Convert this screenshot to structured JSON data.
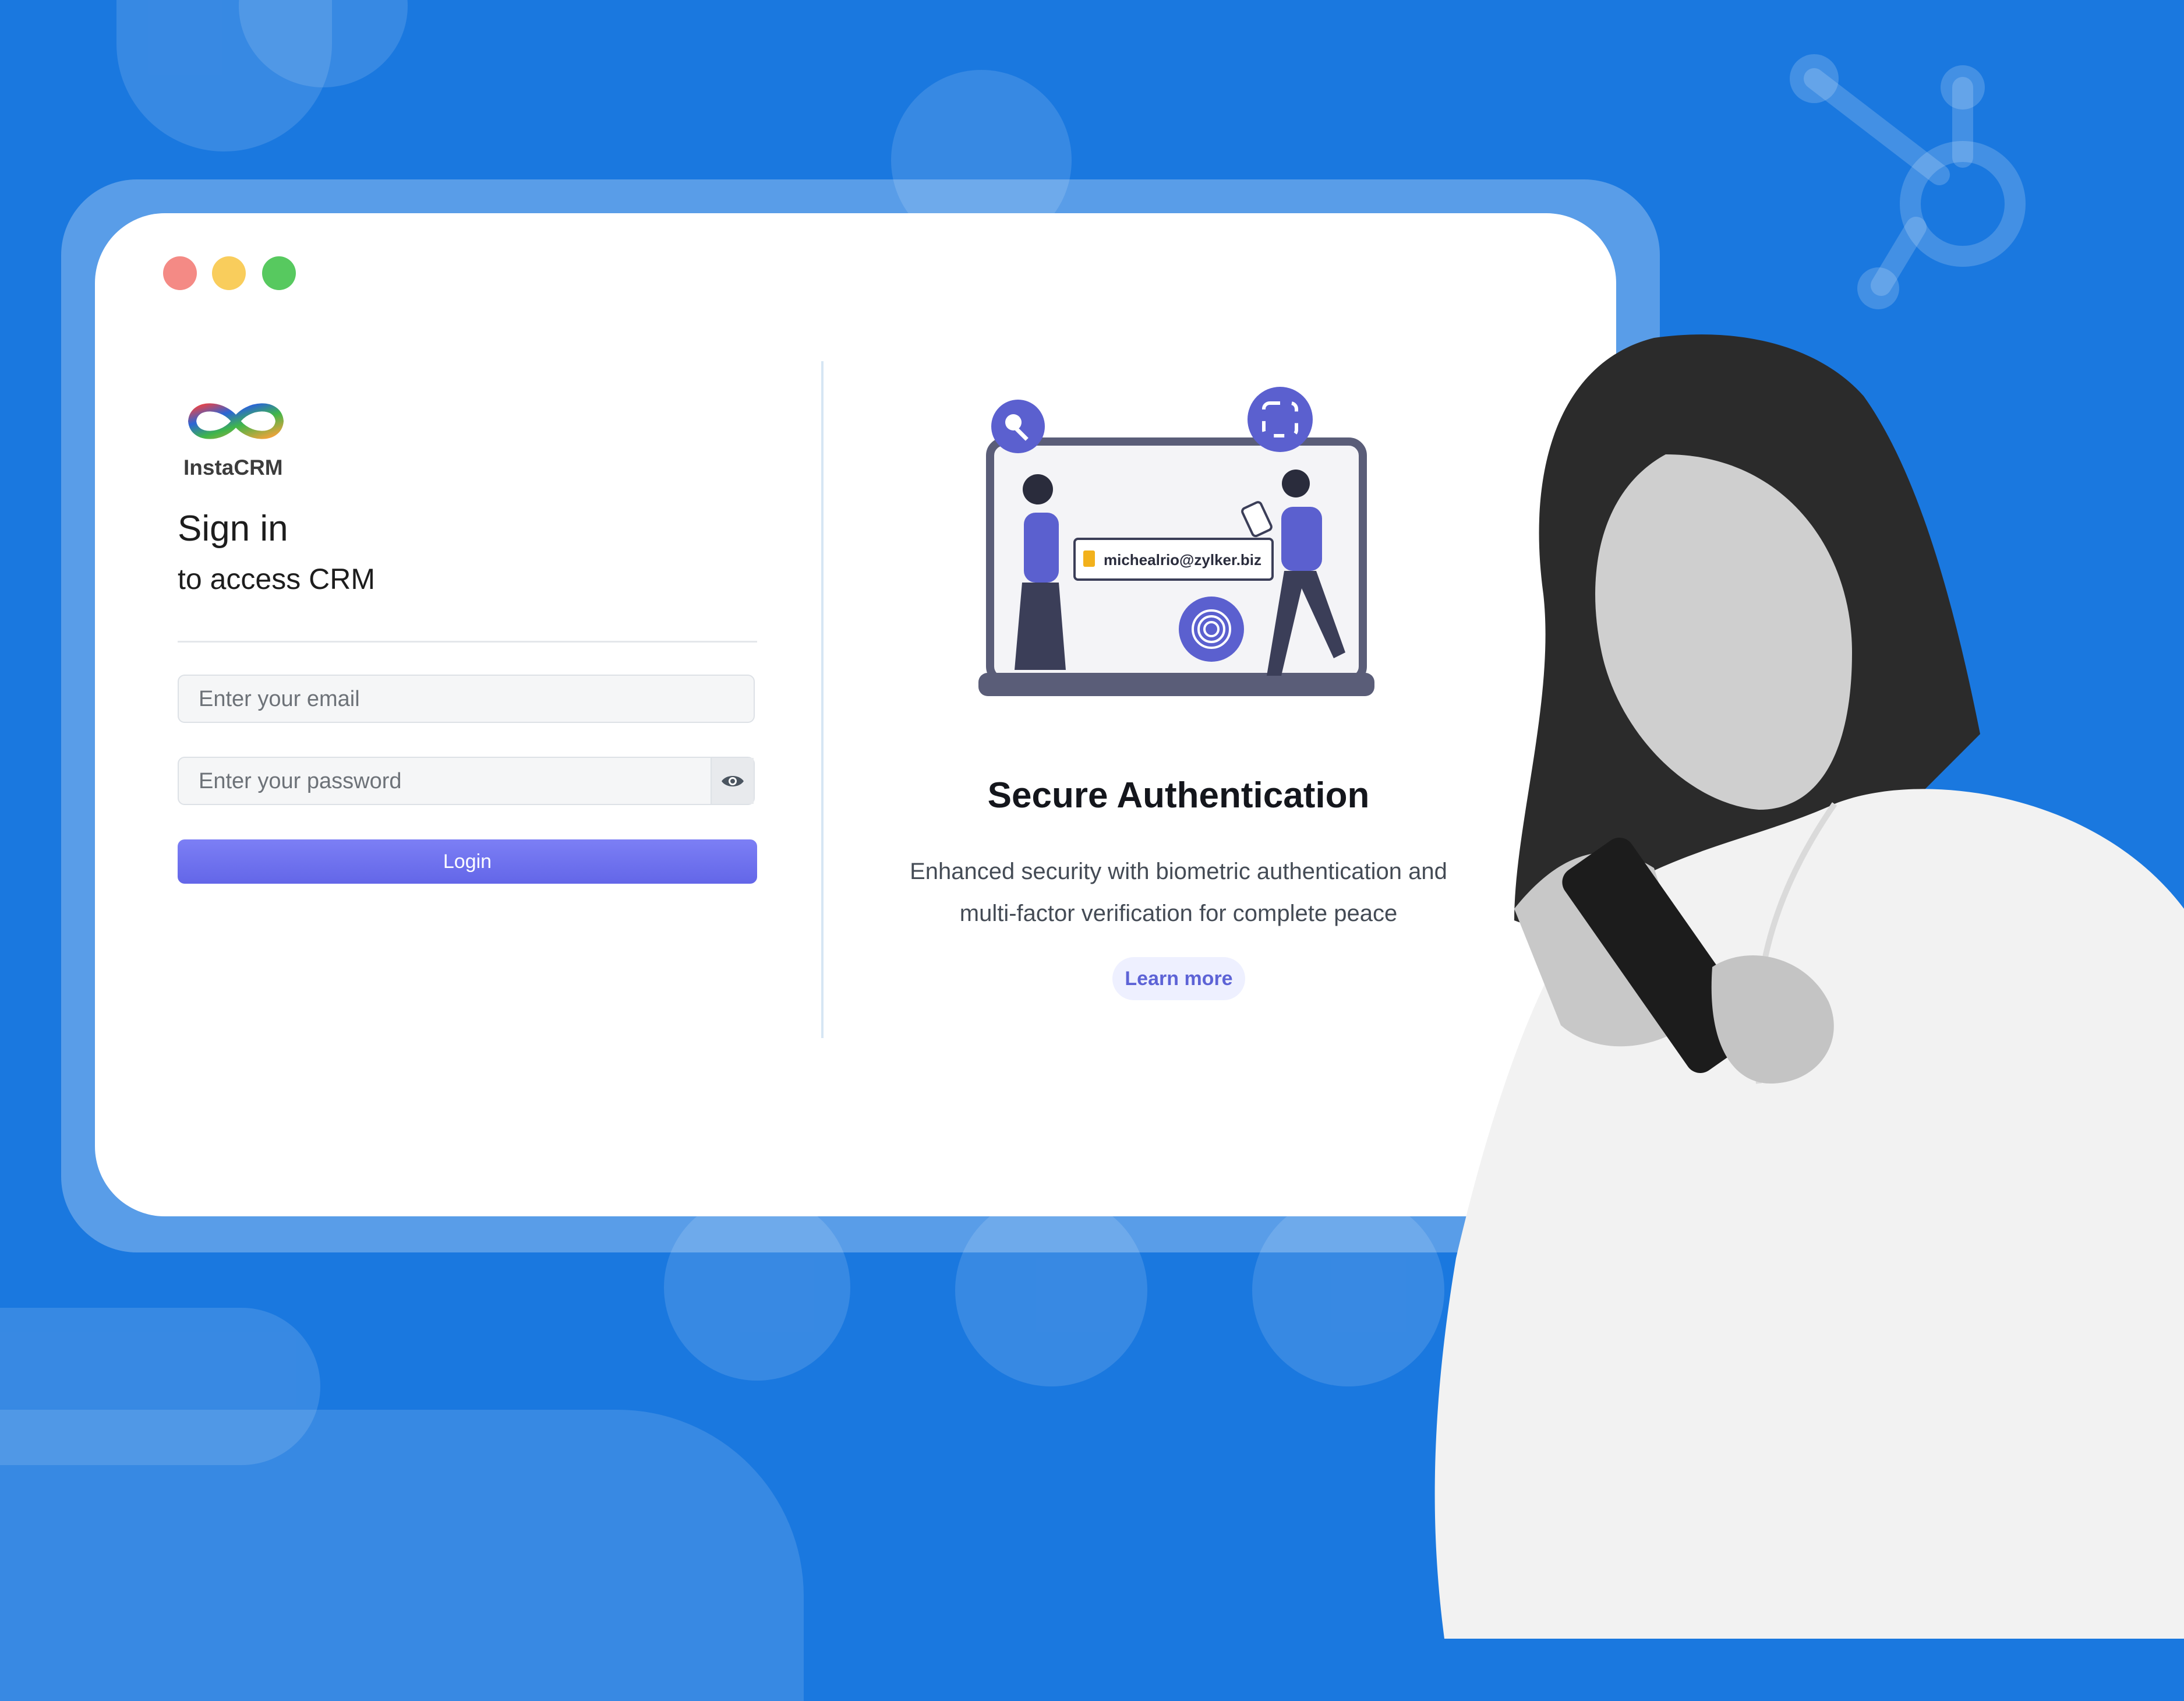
{
  "brand": {
    "name": "InstaCRM"
  },
  "signin": {
    "title": "Sign in",
    "subtitle": "to access CRM",
    "email_placeholder": "Enter your email",
    "password_placeholder": "Enter your password",
    "login_label": "Login"
  },
  "feature": {
    "illustration_email": "michealrio@zylker.biz",
    "title": "Secure Authentication",
    "description_line1": "Enhanced security with biometric authentication and",
    "description_line2": "multi-factor verification for complete peace",
    "learn_more": "Learn more"
  },
  "window_controls": [
    {
      "name": "close",
      "color": "#f48a85"
    },
    {
      "name": "minimize",
      "color": "#f9cd5c"
    },
    {
      "name": "maximize",
      "color": "#57c95f"
    }
  ],
  "colors": {
    "background": "#1a78df",
    "accent": "#6366e8",
    "card": "#ffffff"
  }
}
